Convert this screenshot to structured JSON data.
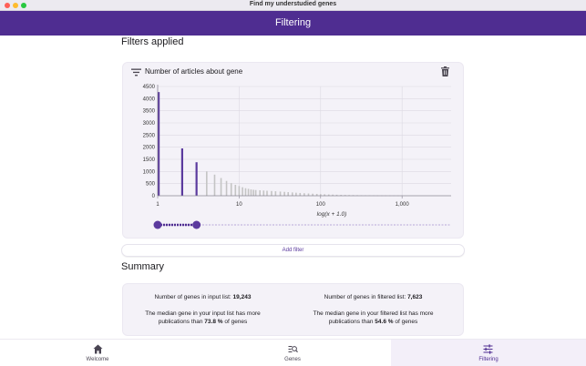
{
  "window": {
    "title": "Find my understudied genes",
    "controls": [
      "close",
      "minimize",
      "zoom"
    ]
  },
  "appbar": {
    "title": "Filtering"
  },
  "filters_section": {
    "title": "Filters applied"
  },
  "filter_card": {
    "name": "Number of articles about gene",
    "icon": "filter-icon",
    "delete_icon": "trash-icon"
  },
  "add_filter": {
    "label": "Add filter"
  },
  "summary": {
    "title": "Summary",
    "input_count_label": "Number of genes in input list: ",
    "input_count_value": "19,243",
    "filtered_count_label": "Number of genes in filtered list: ",
    "filtered_count_value": "7,623",
    "input_median_line1": "The median gene in your input list has more",
    "input_median_pre": "publications than ",
    "input_median_value": "73.8 %",
    "input_median_post": " of genes",
    "filtered_median_line1": "The median gene in your filtered list has more",
    "filtered_median_pre": "publications than ",
    "filtered_median_value": "54.6 %",
    "filtered_median_post": " of genes"
  },
  "nav": {
    "items": [
      {
        "label": "Welcome",
        "icon": "home-icon",
        "active": false
      },
      {
        "label": "Genes",
        "icon": "gene-search-icon",
        "active": false
      },
      {
        "label": "Filtering",
        "icon": "tune-icon",
        "active": true
      }
    ]
  },
  "colors": {
    "primary": "#4f2d91",
    "selected_bar": "#5b3a9e",
    "unselected_bar": "#c4c4c4",
    "card_background": "#f4f2f8"
  },
  "chart_data": {
    "type": "bar",
    "x_scale": "log",
    "xlabel": "log(x + 1.0)",
    "ylabel": "",
    "title": "",
    "x_ticks": [
      1,
      10,
      100,
      1000
    ],
    "x_tick_labels": [
      "1",
      "10",
      "100",
      "1,000"
    ],
    "y_ticks": [
      0,
      500,
      1000,
      1500,
      2000,
      2500,
      3000,
      3500,
      4000,
      4500
    ],
    "ylim": [
      0,
      4500
    ],
    "xlim": [
      1,
      4000
    ],
    "grid": true,
    "range_selection": {
      "min": 1,
      "max": 3
    },
    "bars": [
      {
        "x": 1,
        "value": 4270,
        "selected": true
      },
      {
        "x": 2,
        "value": 1950,
        "selected": true
      },
      {
        "x": 3,
        "value": 1380,
        "selected": true
      },
      {
        "x": 4,
        "value": 1000,
        "selected": false
      },
      {
        "x": 5,
        "value": 870,
        "selected": false
      },
      {
        "x": 6,
        "value": 730,
        "selected": false
      },
      {
        "x": 7,
        "value": 610,
        "selected": false
      },
      {
        "x": 8,
        "value": 520,
        "selected": false
      },
      {
        "x": 9,
        "value": 450,
        "selected": false
      },
      {
        "x": 10,
        "value": 400,
        "selected": false
      },
      {
        "x": 11,
        "value": 350,
        "selected": false
      },
      {
        "x": 12,
        "value": 310,
        "selected": false
      },
      {
        "x": 13,
        "value": 285,
        "selected": false
      },
      {
        "x": 14,
        "value": 260,
        "selected": false
      },
      {
        "x": 15,
        "value": 245,
        "selected": false
      },
      {
        "x": 16,
        "value": 235,
        "selected": false
      },
      {
        "x": 18,
        "value": 225,
        "selected": false
      },
      {
        "x": 20,
        "value": 215,
        "selected": false
      },
      {
        "x": 22,
        "value": 205,
        "selected": false
      },
      {
        "x": 25,
        "value": 195,
        "selected": false
      },
      {
        "x": 28,
        "value": 185,
        "selected": false
      },
      {
        "x": 32,
        "value": 172,
        "selected": false
      },
      {
        "x": 36,
        "value": 160,
        "selected": false
      },
      {
        "x": 40,
        "value": 148,
        "selected": false
      },
      {
        "x": 45,
        "value": 136,
        "selected": false
      },
      {
        "x": 50,
        "value": 125,
        "selected": false
      },
      {
        "x": 56,
        "value": 114,
        "selected": false
      },
      {
        "x": 63,
        "value": 104,
        "selected": false
      },
      {
        "x": 71,
        "value": 94,
        "selected": false
      },
      {
        "x": 80,
        "value": 85,
        "selected": false
      },
      {
        "x": 90,
        "value": 76,
        "selected": false
      },
      {
        "x": 100,
        "value": 68,
        "selected": false
      },
      {
        "x": 112,
        "value": 60,
        "selected": false
      },
      {
        "x": 126,
        "value": 53,
        "selected": false
      },
      {
        "x": 141,
        "value": 47,
        "selected": false
      },
      {
        "x": 158,
        "value": 41,
        "selected": false
      },
      {
        "x": 178,
        "value": 36,
        "selected": false
      },
      {
        "x": 200,
        "value": 32,
        "selected": false
      },
      {
        "x": 224,
        "value": 28,
        "selected": false
      },
      {
        "x": 251,
        "value": 25,
        "selected": false
      },
      {
        "x": 282,
        "value": 22,
        "selected": false
      },
      {
        "x": 316,
        "value": 19,
        "selected": false
      },
      {
        "x": 355,
        "value": 17,
        "selected": false
      },
      {
        "x": 398,
        "value": 15,
        "selected": false
      },
      {
        "x": 447,
        "value": 13,
        "selected": false
      },
      {
        "x": 501,
        "value": 11,
        "selected": false
      },
      {
        "x": 562,
        "value": 10,
        "selected": false
      },
      {
        "x": 631,
        "value": 9,
        "selected": false
      },
      {
        "x": 708,
        "value": 8,
        "selected": false
      },
      {
        "x": 794,
        "value": 7,
        "selected": false
      },
      {
        "x": 891,
        "value": 6,
        "selected": false
      },
      {
        "x": 1000,
        "value": 5,
        "selected": false
      }
    ]
  }
}
